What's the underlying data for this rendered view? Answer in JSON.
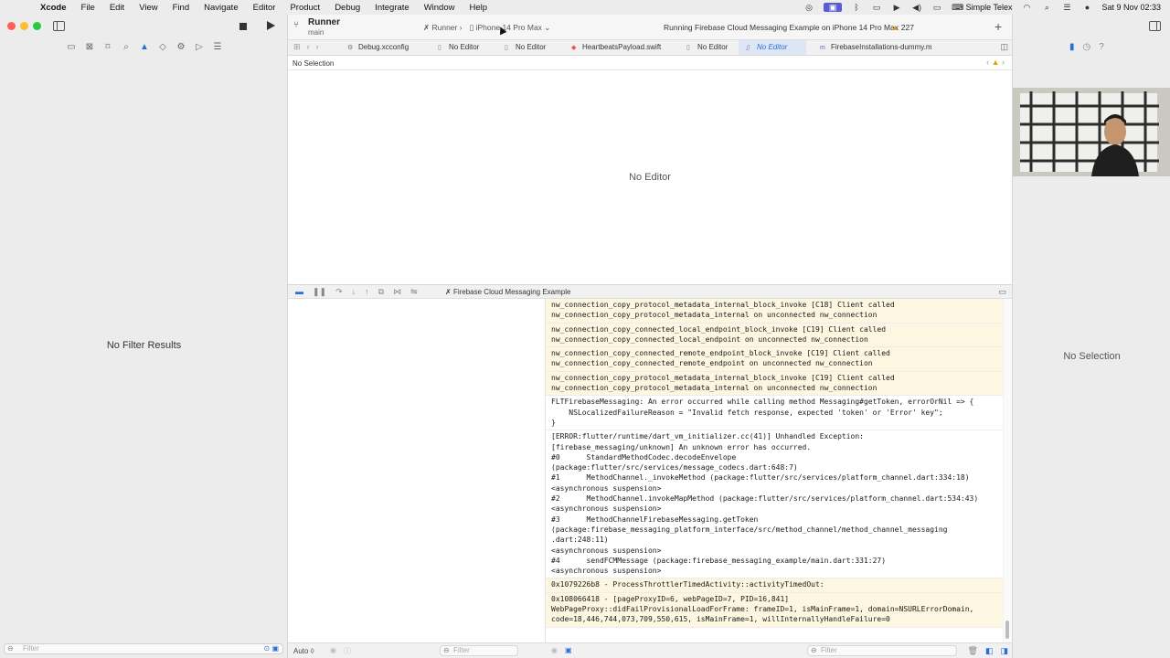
{
  "menubar": {
    "app_name": "Xcode",
    "items": [
      "File",
      "Edit",
      "View",
      "Find",
      "Navigate",
      "Editor",
      "Product",
      "Debug",
      "Integrate",
      "Window",
      "Help"
    ],
    "input_source": "Simple Telex",
    "clock": "Sat 9 Nov  02:33"
  },
  "toolbar": {
    "scheme_name": "Runner",
    "branch": "main",
    "breadcrumb_scheme": "Runner",
    "breadcrumb_device": "iPhone 14 Pro Max",
    "status": "Running Firebase Cloud Messaging Example on iPhone 14 Pro Max",
    "warning_count": "227"
  },
  "navigator": {
    "empty_message": "No Filter Results",
    "filter_placeholder": "Filter"
  },
  "tabs": [
    {
      "label": "Debug.xcconfig",
      "active": false
    },
    {
      "label": "No Editor",
      "active": false
    },
    {
      "label": "No Editor",
      "active": false
    },
    {
      "label": "HeartbeatsPayload.swift",
      "active": false
    },
    {
      "label": "No Editor",
      "active": false
    },
    {
      "label": "No Editor",
      "active": true
    },
    {
      "label": "FirebaseInstallations-dummy.m",
      "active": false
    }
  ],
  "jumpbar": {
    "text": "No Selection"
  },
  "editor": {
    "message": "No Editor"
  },
  "debugbar": {
    "target": "Firebase Cloud Messaging Example"
  },
  "console": {
    "blocks": [
      {
        "warn": true,
        "text": "nw_connection_copy_protocol_metadata_internal_block_invoke [C18] Client called\nnw_connection_copy_protocol_metadata_internal on unconnected nw_connection"
      },
      {
        "warn": true,
        "text": "nw_connection_copy_connected_local_endpoint_block_invoke [C19] Client called\nnw_connection_copy_connected_local_endpoint on unconnected nw_connection"
      },
      {
        "warn": true,
        "text": "nw_connection_copy_connected_remote_endpoint_block_invoke [C19] Client called\nnw_connection_copy_connected_remote_endpoint on unconnected nw_connection"
      },
      {
        "warn": true,
        "text": "nw_connection_copy_protocol_metadata_internal_block_invoke [C19] Client called\nnw_connection_copy_protocol_metadata_internal on unconnected nw_connection"
      },
      {
        "warn": false,
        "text": "FLTFirebaseMessaging: An error occurred while calling method Messaging#getToken, errorOrNil => {\n    NSLocalizedFailureReason = \"Invalid fetch response, expected 'token' or 'Error' key\";\n}"
      },
      {
        "warn": false,
        "text": "[ERROR:flutter/runtime/dart_vm_initializer.cc(41)] Unhandled Exception:\n[firebase_messaging/unknown] An unknown error has occurred.\n#0      StandardMethodCodec.decodeEnvelope\n(package:flutter/src/services/message_codecs.dart:648:7)\n#1      MethodChannel._invokeMethod (package:flutter/src/services/platform_channel.dart:334:18)\n<asynchronous suspension>\n#2      MethodChannel.invokeMapMethod (package:flutter/src/services/platform_channel.dart:534:43)\n<asynchronous suspension>\n#3      MethodChannelFirebaseMessaging.getToken\n(package:firebase_messaging_platform_interface/src/method_channel/method_channel_messaging\n.dart:248:11)\n<asynchronous suspension>\n#4      sendFCMMessage (package:firebase_messaging_example/main.dart:331:27)\n<asynchronous suspension>"
      },
      {
        "warn": true,
        "text": "0x1079226b8 - ProcessThrottlerTimedActivity::activityTimedOut:"
      },
      {
        "warn": true,
        "text": "0x108066418 - [pageProxyID=6, webPageID=7, PID=16,841]\nWebPageProxy::didFailProvisionalLoadForFrame: frameID=1, isMainFrame=1, domain=NSURLErrorDomain,\ncode=18,446,744,073,709,550,615, isMainFrame=1, willInternallyHandleFailure=0"
      }
    ]
  },
  "bottombar": {
    "auto_label": "Auto ◊",
    "filter_placeholder": "Filter"
  },
  "inspector": {
    "empty_message": "No Selection"
  }
}
